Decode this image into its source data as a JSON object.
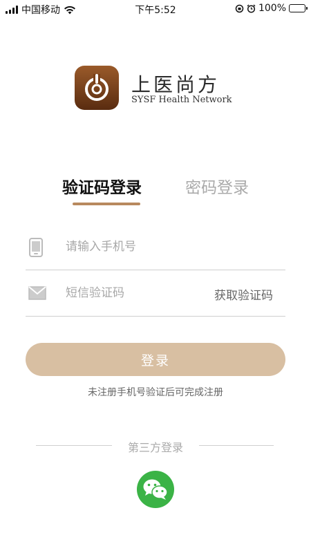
{
  "status_bar": {
    "carrier": "中国移动",
    "time": "下午5:52",
    "battery": "100%"
  },
  "brand": {
    "name_cn": "上医尚方",
    "name_en": "SYSF Health Network"
  },
  "tabs": [
    {
      "label": "验证码登录",
      "active": true
    },
    {
      "label": "密码登录",
      "active": false
    }
  ],
  "form": {
    "phone_placeholder": "请输入手机号",
    "code_placeholder": "短信验证码",
    "get_code_label": "获取验证码",
    "login_label": "登录",
    "hint": "未注册手机号验证后可完成注册"
  },
  "third_party": {
    "label": "第三方登录"
  },
  "colors": {
    "accent": "#b8895e",
    "login_button": "#d8bfa2",
    "wechat": "#3bb346"
  },
  "icons": {
    "phone": "phone-icon",
    "mail": "mail-icon",
    "wechat": "wechat-icon"
  }
}
